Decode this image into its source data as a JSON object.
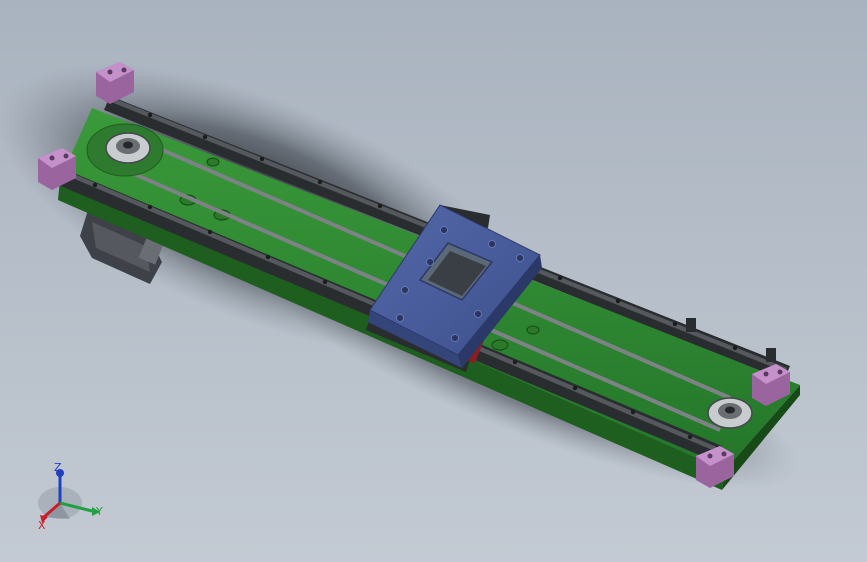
{
  "colors": {
    "background_light": "#b6c0cc",
    "background_dark": "#1f2328",
    "plate_green": "#2f8a2f",
    "plate_green_dark": "#1e5e1e",
    "rail_dark": "#2a2d30",
    "rail_mid": "#55595d",
    "end_block_pink": "#b07ab8",
    "carriage_blue": "#4a5fa0",
    "carriage_blue_dark": "#34457a",
    "belt_gray": "#7e8287",
    "motor_gray": "#4a4d52",
    "stopper_red": "#8a1e1e",
    "axis_x": "#c8202a",
    "axis_y": "#20a040",
    "axis_z": "#2040c0"
  },
  "model": {
    "name": "linear-belt-actuator",
    "parts": [
      "base-plate",
      "linear-rail-upper",
      "linear-rail-lower",
      "timing-belt",
      "drive-pulley",
      "idler-pulley",
      "stepper-motor",
      "carriage-plate",
      "end-block",
      "limit-switch"
    ]
  },
  "triad": {
    "x_label": "X",
    "y_label": "Y",
    "z_label": "Z"
  }
}
